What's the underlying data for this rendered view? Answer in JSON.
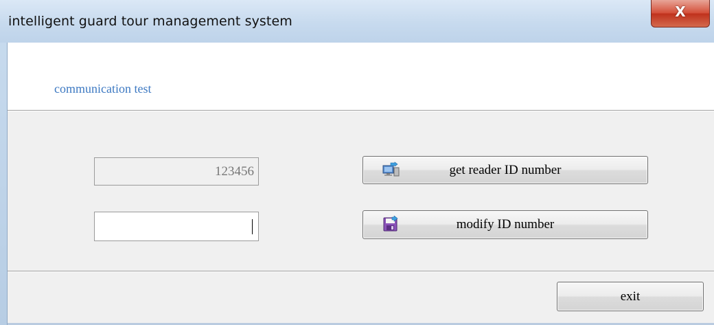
{
  "window": {
    "title": "intelligent guard tour management system",
    "close_glyph": "X"
  },
  "header": {
    "title": "communication test"
  },
  "form": {
    "reader_id_value": "123456",
    "new_id_value": ""
  },
  "buttons": {
    "get_reader_id": {
      "label": "get reader ID number",
      "icon": "computer-transfer-icon"
    },
    "modify_id": {
      "label": "modify ID number",
      "icon": "save-disk-icon"
    },
    "exit": {
      "label": "exit"
    }
  },
  "colors": {
    "header_text": "#3d79c2",
    "close_button": "#c0321d"
  }
}
